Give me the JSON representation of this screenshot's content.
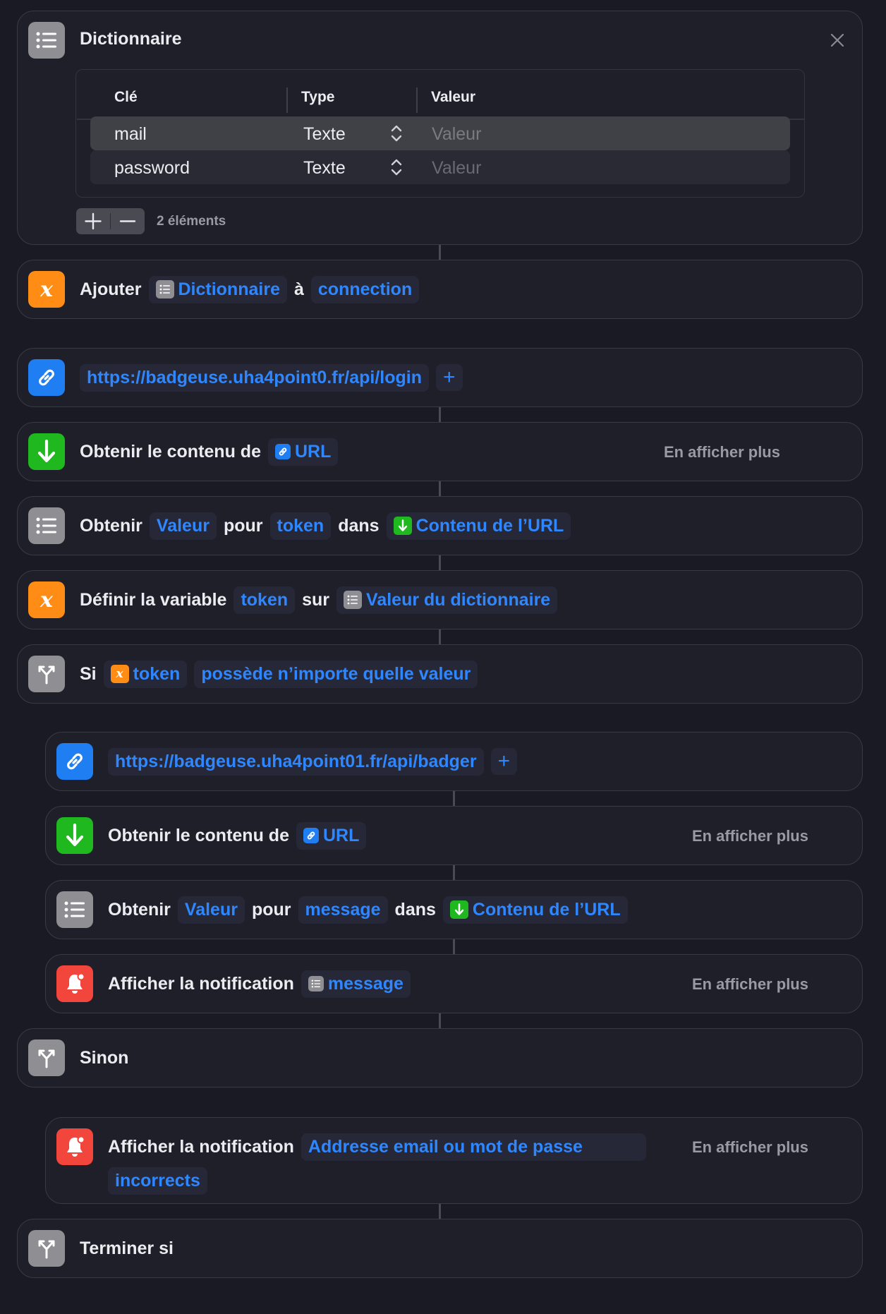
{
  "dictionary": {
    "title": "Dictionnaire",
    "columns": {
      "key": "Clé",
      "type": "Type",
      "value": "Valeur"
    },
    "rows": [
      {
        "key": "mail",
        "type": "Texte",
        "value_placeholder": "Valeur"
      },
      {
        "key": "password",
        "type": "Texte",
        "value_placeholder": "Valeur"
      }
    ],
    "count": "2 éléments"
  },
  "add_action": {
    "verb": "Ajouter",
    "var": "Dictionnaire",
    "sep": "à",
    "target": "connection"
  },
  "url1": {
    "url": "https://badgeuse.uha4point0.fr/api/login",
    "plus": "+"
  },
  "get1": {
    "label": "Obtenir le contenu de",
    "var": "URL",
    "more": "En afficher plus"
  },
  "getval1": {
    "verb": "Obtenir",
    "val": "Valeur",
    "pour": "pour",
    "key": "token",
    "dans": "dans",
    "src": "Contenu de l’URL"
  },
  "setvar": {
    "label": "Définir la variable",
    "var": "token",
    "sur": "sur",
    "src": "Valeur du dictionnaire"
  },
  "if_block": {
    "label": "Si",
    "var": "token",
    "cond": "possède n’importe quelle valeur"
  },
  "url2": {
    "url": "https://badgeuse.uha4point01.fr/api/badger",
    "plus": "+"
  },
  "get2": {
    "label": "Obtenir le contenu de",
    "var": "URL",
    "more": "En afficher plus"
  },
  "getval2": {
    "verb": "Obtenir",
    "val": "Valeur",
    "pour": "pour",
    "key": "message",
    "dans": "dans",
    "src": "Contenu de l’URL"
  },
  "notif1": {
    "label": "Afficher la notification",
    "var": "message",
    "more": "En afficher plus"
  },
  "else_block": {
    "label": "Sinon"
  },
  "notif2": {
    "label": "Afficher la notification",
    "text1": "Addresse email ou mot de passe",
    "text2": "incorrects",
    "more": "En afficher plus"
  },
  "endif": {
    "label": "Terminer si"
  },
  "colors": {
    "accent": "#2f87ff",
    "orange": "#ff8c14",
    "green": "#1fb81f",
    "red": "#f2463c",
    "gray": "#8e8e93",
    "background": "#1a1a24"
  },
  "icons": [
    "list-icon",
    "variable-icon",
    "link-icon",
    "download-arrow-icon",
    "branch-icon",
    "bell-icon",
    "close-icon",
    "stepper-icon"
  ]
}
